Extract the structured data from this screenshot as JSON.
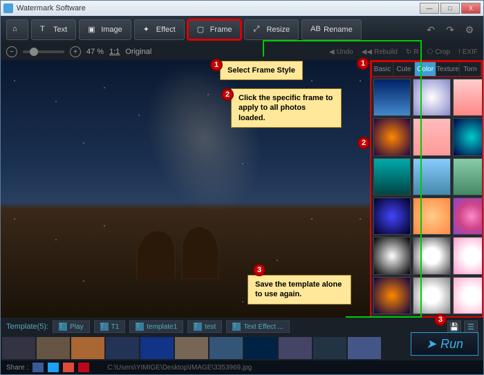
{
  "window": {
    "title": "Watermark Software"
  },
  "winbtns": {
    "min": "—",
    "max": "□",
    "close": "X"
  },
  "toolbar": {
    "home": "⌂",
    "text": "Text",
    "image": "Image",
    "effect": "Effect",
    "frame": "Frame",
    "resize": "Resize",
    "rename": "Rename"
  },
  "util": {
    "undo": "↶",
    "redo": "↷",
    "settings": "⚙"
  },
  "zoom": {
    "minus": "−",
    "plus": "+",
    "pct": "47 %",
    "ratio": "1:1",
    "original": "Original"
  },
  "subacts": {
    "undo": "Undo",
    "rebuild": "Rebuild",
    "rotate": "R",
    "crop": "Crop",
    "exif": "EXIF"
  },
  "tabs": [
    "Basic",
    "Cute",
    "Color",
    "Texture",
    "Torn"
  ],
  "activeTab": 2,
  "templates": {
    "label": "Template(5):",
    "items": [
      "Play",
      "T1",
      "template1",
      "test",
      "Text Effect ..."
    ]
  },
  "run": "Run",
  "share": {
    "label": "Share :",
    "path": "C:\\Users\\YIMIGE\\Desktop\\IMAGE\\3353969.jpg"
  },
  "callouts": {
    "c1": "Select Frame Style",
    "c2": "Click the specific frame to apply to all photos loaded.",
    "c3": "Save the template alone to use again."
  },
  "badges": {
    "n1": "1",
    "n2": "2",
    "n3": "3"
  },
  "thumbcolors": [
    "linear-gradient(#026,#48c)",
    "radial-gradient(#fff,#88c)",
    "linear-gradient(#fcc,#f88)",
    "radial-gradient(#f80,#204)",
    "linear-gradient(#fbb,#f99)",
    "radial-gradient(#0cc,#004)",
    "linear-gradient(#0aa,#044)",
    "linear-gradient(#8cf,#48a)",
    "linear-gradient(#8ca,#486)",
    "radial-gradient(#44f,#002)",
    "radial-gradient(#fc8,#f84)",
    "radial-gradient(#f8c,#c48,#84c)",
    "radial-gradient(#fff,#000)",
    "radial-gradient(#fff 30%,#444)",
    "radial-gradient(#fff 30%,#f9c)",
    "radial-gradient(#f80,#104)",
    "radial-gradient(#fff 30%,#888)",
    "radial-gradient(#fff 30%,#fac)"
  ],
  "stripcolors": [
    "#334",
    "#654",
    "#a63",
    "#235",
    "#138",
    "#765",
    "#357",
    "#024",
    "#446",
    "#234",
    "#458"
  ]
}
